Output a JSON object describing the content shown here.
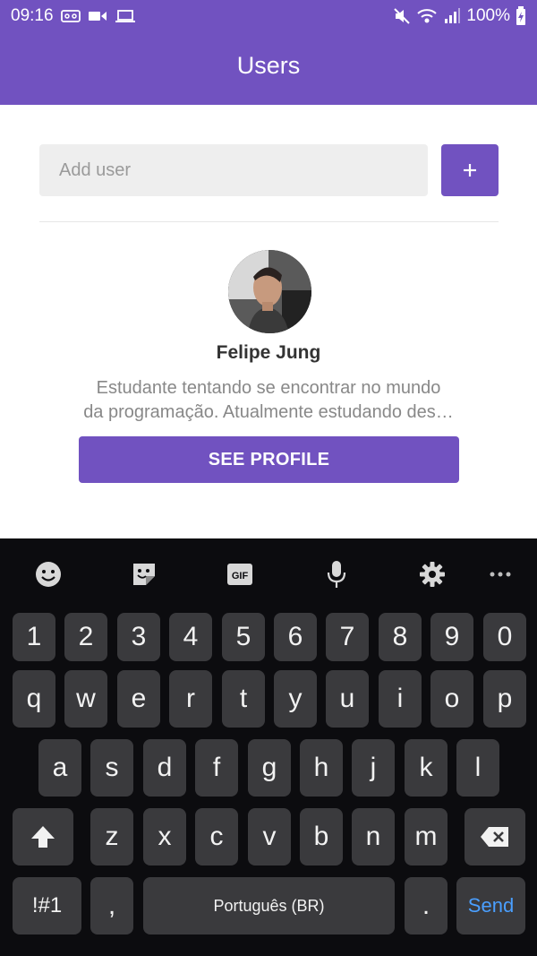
{
  "status_bar": {
    "time": "09:16",
    "battery": "100%"
  },
  "header": {
    "title": "Users"
  },
  "add_user": {
    "placeholder": "Add user",
    "button_label": "+"
  },
  "user_card": {
    "name": "Felipe Jung",
    "bio_line1": "Estudante tentando se encontrar no mundo",
    "bio_line2": "da programação. Atualmente estudando des…",
    "button_label": "SEE PROFILE"
  },
  "keyboard": {
    "toolbar_icons": [
      "emoji-icon",
      "sticker-icon",
      "gif-icon",
      "mic-icon",
      "settings-icon",
      "more-icon"
    ],
    "gif_label": "GIF",
    "row_numbers": [
      "1",
      "2",
      "3",
      "4",
      "5",
      "6",
      "7",
      "8",
      "9",
      "0"
    ],
    "row_q": [
      "q",
      "w",
      "e",
      "r",
      "t",
      "y",
      "u",
      "i",
      "o",
      "p"
    ],
    "row_a": [
      "a",
      "s",
      "d",
      "f",
      "g",
      "h",
      "j",
      "k",
      "l"
    ],
    "row_z": [
      "z",
      "x",
      "c",
      "v",
      "b",
      "n",
      "m"
    ],
    "symbols_label": "!#1",
    "comma_label": ",",
    "space_label": "Português (BR)",
    "period_label": ".",
    "send_label": "Send"
  }
}
